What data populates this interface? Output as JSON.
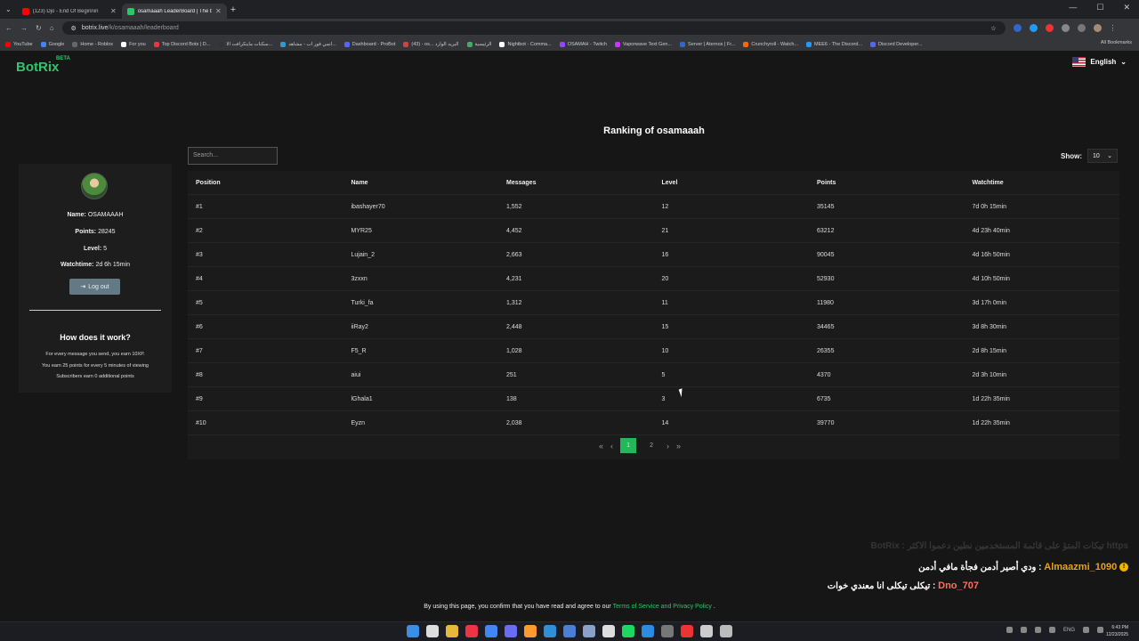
{
  "browser": {
    "tabs": [
      {
        "title": "(123) Djo - End Of Beginnin",
        "fav": "#ff0000",
        "active": false
      },
      {
        "title": "osamaaah LeaderBoard | The b",
        "fav": "#2fc56a",
        "active": true
      }
    ],
    "url_host": "botrix.live",
    "url_path": "/k/osamaaah/leaderboard",
    "bookmarks": [
      "YouTube",
      "Google",
      "Home - Roblox",
      "For you",
      "Top Discord Bots | D...",
      "سكنات ماينكرافت الا...",
      "انمي فور اب - مشاهد...",
      "Dashboard - ProBot",
      "(43) - os... البريد الوارد",
      "الرئيسية",
      "Nightbot - Comma...",
      "OSAMAH - Twitch",
      "Vaporwave Text Gen...",
      "Server | Aternos | Fr...",
      "Crunchyroll - Watch...",
      "MEE6 - The Discord...",
      "Discord Developer..."
    ],
    "bookmark_colors": [
      "#ff0000",
      "#4285f4",
      "#666",
      "#fff",
      "#e34",
      "#333",
      "#39c",
      "#56f",
      "#c44",
      "#4a6",
      "#fff",
      "#9146ff",
      "#c3f",
      "#36c",
      "#f60",
      "#29f",
      "#5865f2"
    ],
    "all_bookmarks": "All Bookmarks"
  },
  "site": {
    "logo": "BotRix",
    "logo_badge": "BETA",
    "language": "English"
  },
  "leaderboard": {
    "title": "Ranking of osamaaah",
    "search_placeholder": "Search...",
    "show_label": "Show:",
    "show_value": "10",
    "columns": [
      "Position",
      "Name",
      "Messages",
      "Level",
      "Points",
      "Watchtime"
    ],
    "rows": [
      [
        "#1",
        "ibashayer70",
        "1,552",
        "12",
        "35145",
        "7d 0h 15min"
      ],
      [
        "#2",
        "MYR25",
        "4,452",
        "21",
        "63212",
        "4d 23h 40min"
      ],
      [
        "#3",
        "Lujain_2",
        "2,663",
        "16",
        "90045",
        "4d 16h 50min"
      ],
      [
        "#4",
        "3zxxn",
        "4,231",
        "20",
        "52930",
        "4d 10h 50min"
      ],
      [
        "#5",
        "Turki_fa",
        "1,312",
        "11",
        "11980",
        "3d 17h 0min"
      ],
      [
        "#6",
        "iiRay2",
        "2,448",
        "15",
        "34465",
        "3d 8h 30min"
      ],
      [
        "#7",
        "F5_R",
        "1,028",
        "10",
        "26355",
        "2d 8h 15min"
      ],
      [
        "#8",
        "aiui",
        "251",
        "5",
        "4370",
        "2d 3h 10min"
      ],
      [
        "#9",
        "lGhala1",
        "138",
        "3",
        "6735",
        "1d 22h 35min"
      ],
      [
        "#10",
        "Eyzn",
        "2,038",
        "14",
        "39770",
        "1d 22h 35min"
      ]
    ],
    "pagination": {
      "first": "«",
      "prev": "‹",
      "current": "1",
      "next_page": "2",
      "next": "›",
      "last": "»"
    }
  },
  "profile": {
    "name_label": "Name:",
    "name": "OSAMAAAH",
    "points_label": "Points:",
    "points": "28245",
    "level_label": "Level:",
    "level": "5",
    "watchtime_label": "Watchtime:",
    "watchtime": "2d 6h 15min",
    "logout": "Log out",
    "how_title": "How does it work?",
    "rules": [
      "For every message you send, you earn 10XP.",
      "You earn 25 points for every 5 minutes of viewing",
      "Subscribers earn 0 additional points"
    ]
  },
  "chat_overlay": {
    "faint": "https  تيكات المتؤ على قائمة المستخدمين نطين دعموا الاكثر : BotRix",
    "user1": "Almaazmi_1090",
    "msg1": "ودي أصير أدمن فجأة مافي أدمن",
    "user2": "Dno_707",
    "msg2": "تيكلى تيكلى انا معندي خوات"
  },
  "consent": {
    "prefix": "By using this page, you confirm that you have read and agree to our",
    "link": "Terms of Service and Privacy Policy",
    "suffix": "."
  },
  "taskbar": {
    "icon_colors": [
      "#3a8ee6",
      "#ddd",
      "#e8b83a",
      "#e34",
      "#4285f4",
      "#6b6bf5",
      "#ff9a2e",
      "#2f8fd8",
      "#4a7fd8",
      "#8aa2c8",
      "#ddd",
      "#1ed760",
      "#2a8be0",
      "#777",
      "#e33",
      "#ccc",
      "#bbb"
    ],
    "lang": "ENG",
    "time": "6:43 PM",
    "date": "12/23/2025"
  }
}
